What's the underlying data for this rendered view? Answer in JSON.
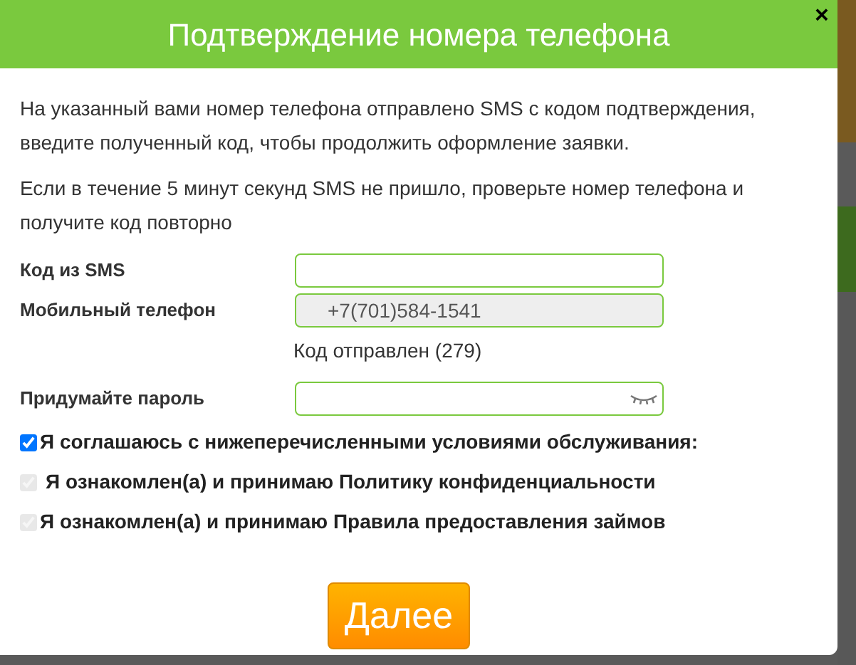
{
  "dialog": {
    "title": "Подтверждение номера телефона",
    "close": "×"
  },
  "paragraphs": [
    "На указанный вами номер телефона отправлено SMS с кодом подтверждения, введите полученный код, чтобы продолжить оформление заявки.",
    "Если в течение 5 минут секунд SMS не пришло, проверьте номер телефона и получите код повторно"
  ],
  "fields": [
    {
      "label": "Код из SMS",
      "disabled": false,
      "kind": "text"
    },
    {
      "label": "Мобильный телефон",
      "value": "+7(701)584-1541",
      "disabled": true,
      "kind": "text",
      "note": "Код отправлен (279)"
    },
    {
      "label": "Придумайте пароль",
      "disabled": false,
      "kind": "password"
    }
  ],
  "agreements": [
    {
      "label": "Я соглашаюсь с нижеперечисленными условиями обслуживания:",
      "checked": true,
      "disabled": false
    },
    {
      "label": "Я ознакомлен(а) и принимаю Политику конфиденциальности",
      "checked": true,
      "disabled": true
    },
    {
      "label": "Я ознакомлен(а) и принимаю Правила предоставления займов",
      "checked": true,
      "disabled": true
    }
  ],
  "submit": "Далее"
}
